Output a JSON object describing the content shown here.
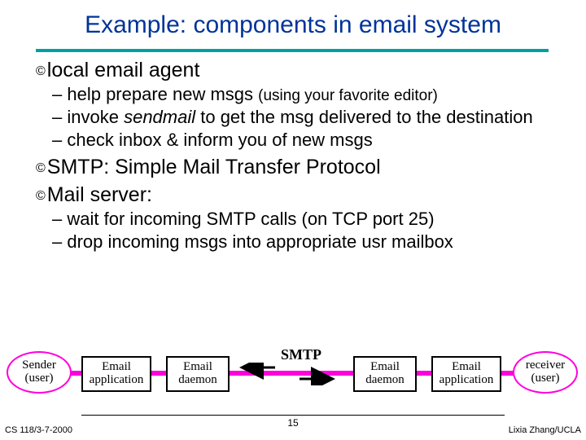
{
  "title": "Example: components in email system",
  "bullets": {
    "b1": "local email agent",
    "b1a_pre": "help prepare new msgs ",
    "b1a_paren": "(using your favorite editor)",
    "b1b_pre": "invoke ",
    "b1b_ital": "sendmail",
    "b1b_post": " to get the msg delivered to the destination",
    "b1c": "check inbox & inform you of new msgs",
    "b2": "SMTP: Simple Mail Transfer Protocol",
    "b3": "Mail server:",
    "b3a": "wait for incoming SMTP calls (on TCP port 25)",
    "b3b": "drop incoming msgs into appropriate usr mailbox"
  },
  "diagram": {
    "sender_l1": "Sender",
    "sender_l2": "(user)",
    "receiver_l1": "receiver",
    "receiver_l2": "(user)",
    "app_l1": "Email",
    "app_l2": "application",
    "daemon_l1": "Email",
    "daemon_l2": "daemon",
    "smtp": "SMTP"
  },
  "footer": {
    "left": "CS 118/3-7-2000",
    "center": "15",
    "right": "Lixia Zhang/UCLA"
  }
}
